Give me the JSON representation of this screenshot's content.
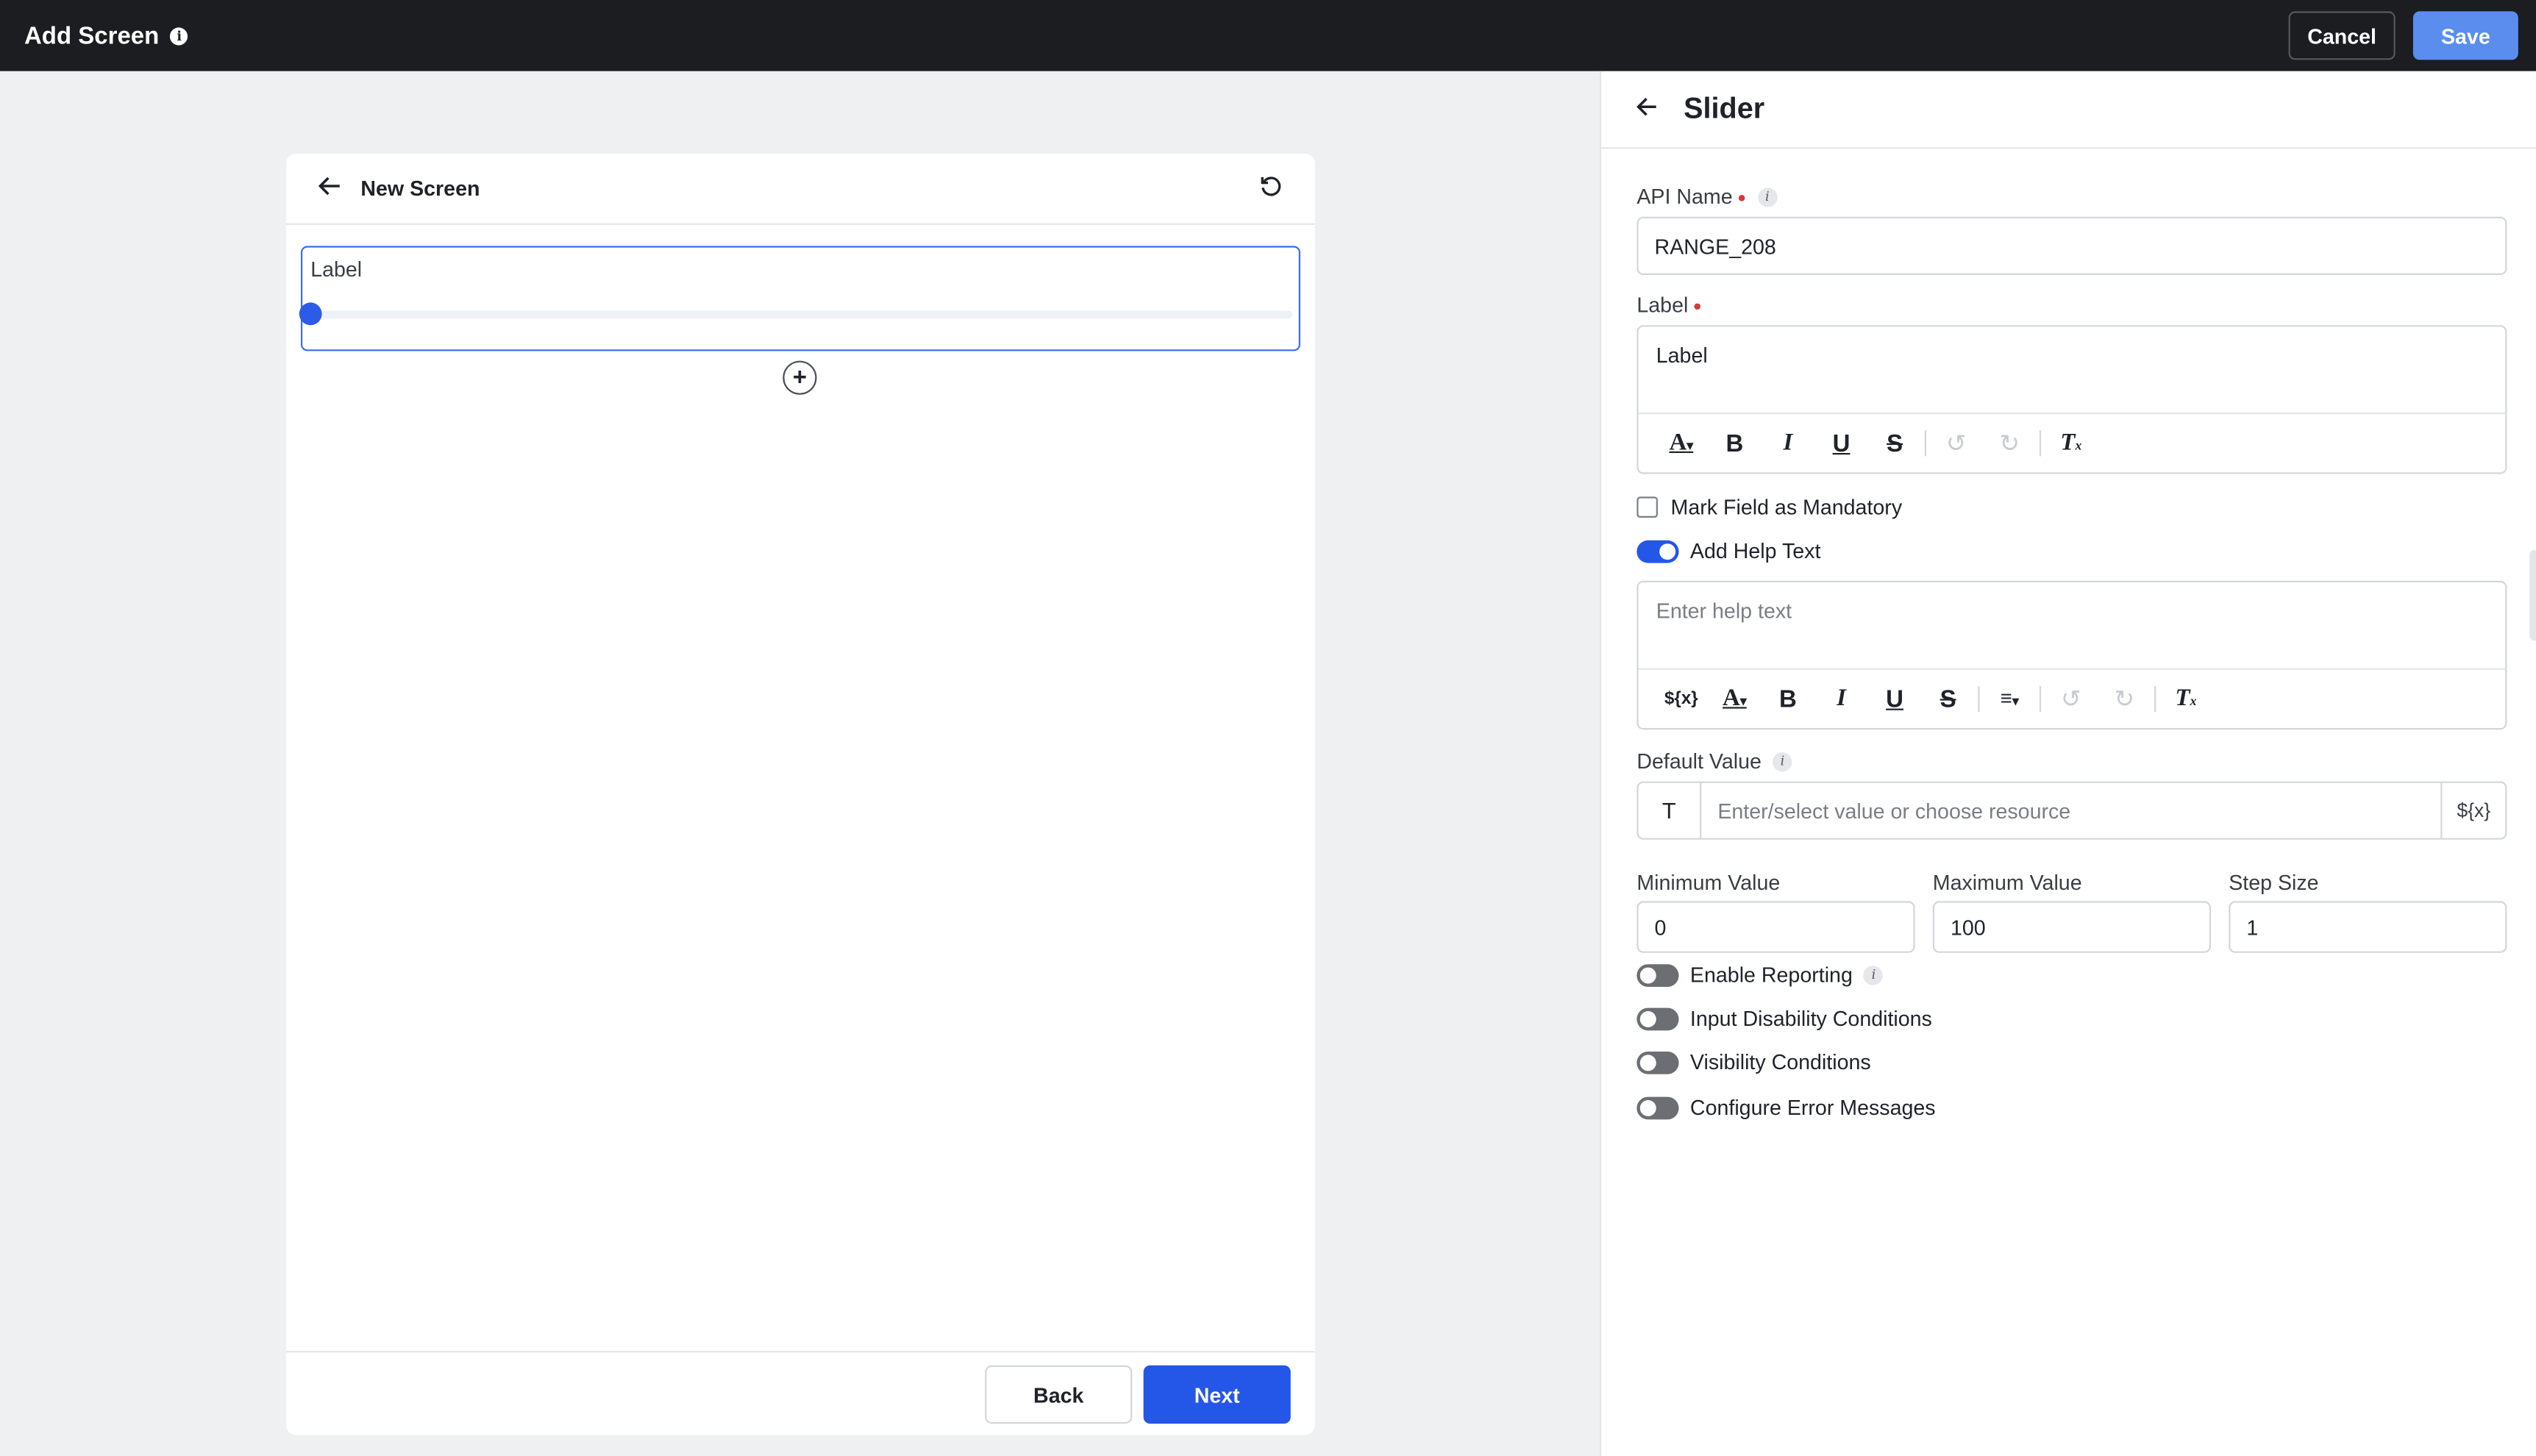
{
  "topbar": {
    "title": "Add Screen",
    "cancel_label": "Cancel",
    "save_label": "Save"
  },
  "screen": {
    "name": "New Screen",
    "field_label": "Label",
    "back_label": "Back",
    "next_label": "Next"
  },
  "panel": {
    "title": "Slider",
    "api_name_label": "API Name",
    "api_name_value": "RANGE_208",
    "label_label": "Label",
    "label_value": "Label",
    "mandatory_label": "Mark Field as Mandatory",
    "help_toggle_label": "Add Help Text",
    "help_placeholder": "Enter help text",
    "default_label": "Default Value",
    "default_type": "T",
    "default_placeholder": "Enter/select value or choose resource",
    "var_token": "${x}",
    "min_label": "Minimum Value",
    "min_value": "0",
    "max_label": "Maximum Value",
    "max_value": "100",
    "step_label": "Step Size",
    "step_value": "1",
    "toggles": {
      "reporting": "Enable Reporting",
      "disability": "Input Disability Conditions",
      "visibility": "Visibility Conditions",
      "errors": "Configure Error Messages"
    },
    "mandatory_checked": false,
    "help_enabled": true
  },
  "colors": {
    "primary": "#2456e8",
    "save": "#5b8def",
    "topbar": "#1b1d20",
    "required": "#d63a3a"
  },
  "icons": [
    "info-icon",
    "back-arrow-icon",
    "refresh-icon",
    "plus-icon",
    "text-color-icon",
    "bold-icon",
    "italic-icon",
    "underline-icon",
    "strikethrough-icon",
    "undo-icon",
    "redo-icon",
    "clear-format-icon",
    "align-icon",
    "variable-icon"
  ]
}
